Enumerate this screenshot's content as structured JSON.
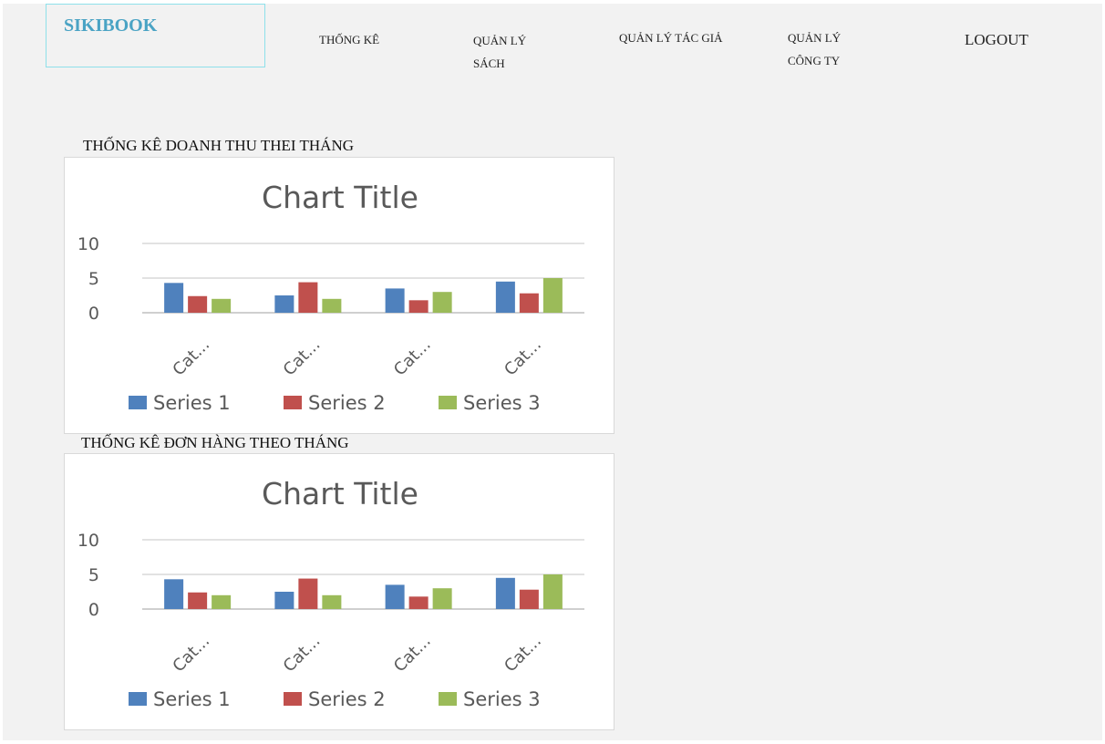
{
  "header": {
    "logo": "SIKIBOOK",
    "nav": [
      {
        "label": "THỐNG KÊ"
      },
      {
        "label": "QUẢN LÝ SÁCH"
      },
      {
        "label": "QUẢN LÝ TÁC GIẢ"
      },
      {
        "label": "QUẢN LÝ CÔNG TY"
      }
    ],
    "logout": "LOGOUT"
  },
  "colors": {
    "page_bg": "#f2f2f2",
    "logo": "#4aa3c4",
    "logo_border": "#8ee0ea",
    "series1": "#4f81bd",
    "series2": "#c0504d",
    "series3": "#9bbb59"
  },
  "sections": [
    {
      "title": "THỐNG KÊ DOANH THU THEI THÁNG"
    },
    {
      "title": "THỐNG KÊ ĐƠN HÀNG THEO THÁNG"
    }
  ],
  "chart_data": [
    {
      "type": "bar",
      "title": "Chart Title",
      "categories": [
        "Cat...",
        "Cat...",
        "Cat...",
        "Cat..."
      ],
      "series": [
        {
          "name": "Series 1",
          "values": [
            4.3,
            2.5,
            3.5,
            4.5
          ],
          "color": "#4f81bd"
        },
        {
          "name": "Series 2",
          "values": [
            2.4,
            4.4,
            1.8,
            2.8
          ],
          "color": "#c0504d"
        },
        {
          "name": "Series 3",
          "values": [
            2,
            2,
            3,
            5
          ],
          "color": "#9bbb59"
        }
      ],
      "yticks": [
        0,
        5,
        10
      ],
      "ylim": [
        0,
        10
      ],
      "grid": true,
      "legend": "bottom"
    },
    {
      "type": "bar",
      "title": "Chart Title",
      "categories": [
        "Cat...",
        "Cat...",
        "Cat...",
        "Cat..."
      ],
      "series": [
        {
          "name": "Series 1",
          "values": [
            4.3,
            2.5,
            3.5,
            4.5
          ],
          "color": "#4f81bd"
        },
        {
          "name": "Series 2",
          "values": [
            2.4,
            4.4,
            1.8,
            2.8
          ],
          "color": "#c0504d"
        },
        {
          "name": "Series 3",
          "values": [
            2,
            2,
            3,
            5
          ],
          "color": "#9bbb59"
        }
      ],
      "yticks": [
        0,
        5,
        10
      ],
      "ylim": [
        0,
        10
      ],
      "grid": true,
      "legend": "bottom"
    }
  ]
}
